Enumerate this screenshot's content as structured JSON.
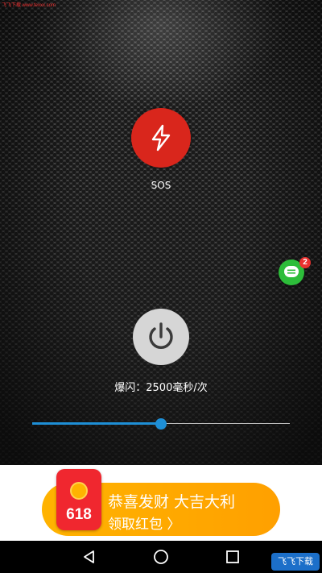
{
  "watermark": "飞飞下载 www.fexxx.com",
  "sos": {
    "label": "SOS",
    "icon": "lightning-icon"
  },
  "chat": {
    "icon": "chat-bubble-icon",
    "badge_count": "2"
  },
  "power": {
    "icon": "power-icon"
  },
  "flash_rate": {
    "text": "爆闪：2500毫秒/次"
  },
  "slider": {
    "value_fraction": 0.5
  },
  "ad": {
    "badge_number": "618",
    "title": "恭喜发财 大吉大利",
    "subtitle": "领取红包 〉"
  },
  "navbar": {
    "back_icon": "back-triangle-icon",
    "home_icon": "home-circle-icon",
    "recents_icon": "recents-square-icon"
  },
  "site_logo": {
    "text": "飞飞下载"
  },
  "colors": {
    "sos": "#d9261c",
    "slider": "#1e8fd6",
    "chat": "#2dbd3a",
    "ad": "#ffb300"
  }
}
